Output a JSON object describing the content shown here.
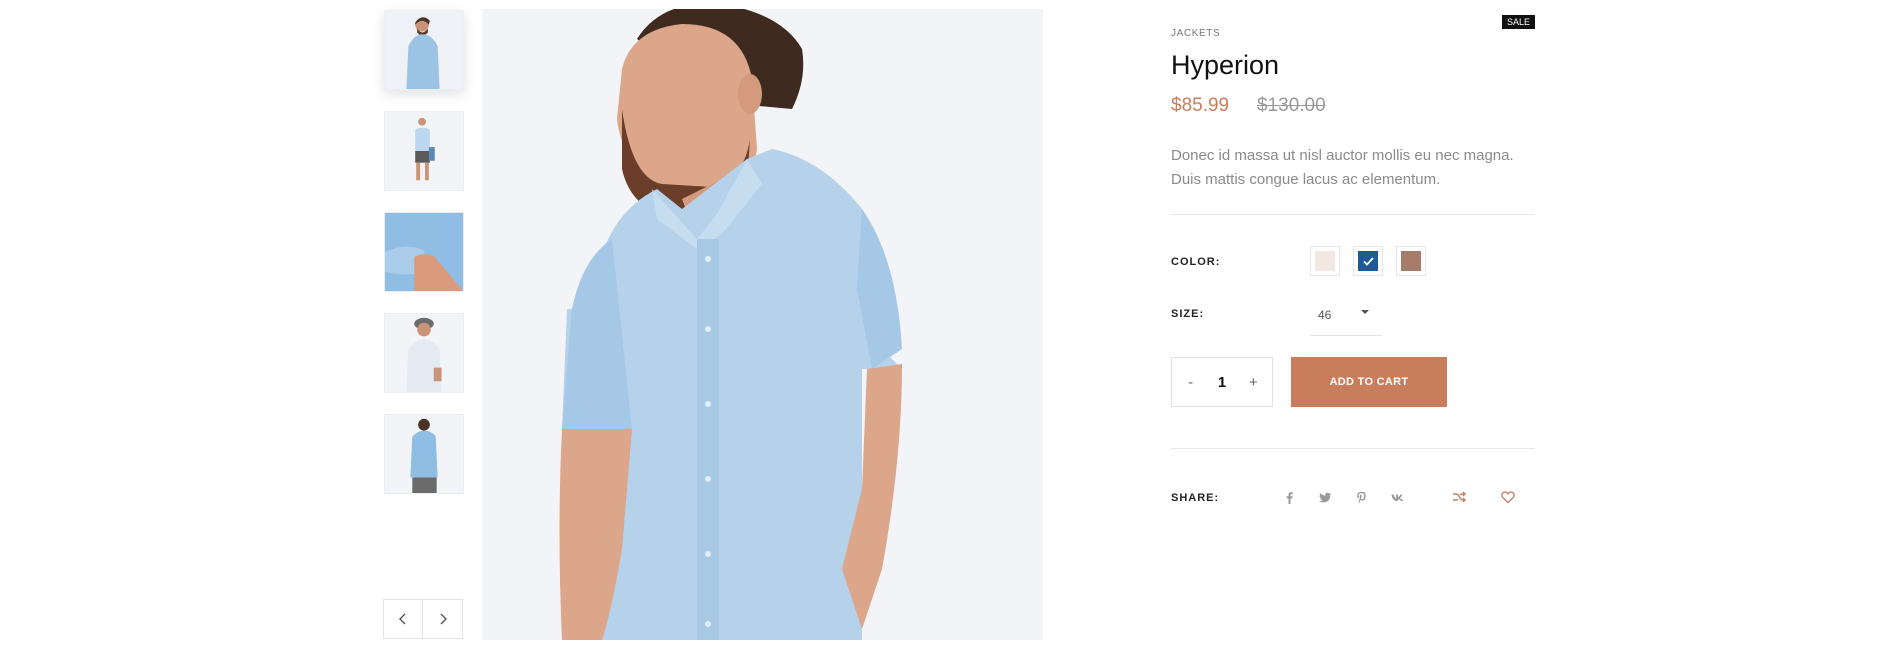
{
  "gallery": {
    "thumbnails": [
      {
        "alt": "front"
      },
      {
        "alt": "full body"
      },
      {
        "alt": "sleeve detail"
      },
      {
        "alt": "back with cap"
      },
      {
        "alt": "back view"
      }
    ],
    "prev_icon": "chevron-left-icon",
    "next_icon": "chevron-right-icon"
  },
  "product": {
    "category": "JACKETS",
    "badge": "SALE",
    "title": "Hyperion",
    "price": "$85.99",
    "old_price": "$130.00",
    "description": "Donec id massa ut nisl auctor mollis eu nec magna. Duis mattis congue lacus ac elementum."
  },
  "options": {
    "color_label": "COLOR:",
    "colors": [
      {
        "name": "cream",
        "hex": "#f3e7e1",
        "selected": false
      },
      {
        "name": "blue",
        "hex": "#1f5a96",
        "selected": true
      },
      {
        "name": "brown",
        "hex": "#a67c6a",
        "selected": false
      }
    ],
    "size_label": "SIZE:",
    "size_value": "46"
  },
  "cart": {
    "minus": "-",
    "quantity": "1",
    "plus": "+",
    "add_label": "ADD TO CART"
  },
  "share": {
    "label": "SHARE:",
    "icons": [
      "facebook-icon",
      "twitter-icon",
      "pinterest-icon",
      "vk-icon"
    ],
    "compare_icon": "shuffle-icon",
    "wishlist_icon": "heart-icon"
  },
  "colors": {
    "accent": "#c97d5d",
    "text_dark": "#111111",
    "text_muted": "#8a8a8a"
  }
}
